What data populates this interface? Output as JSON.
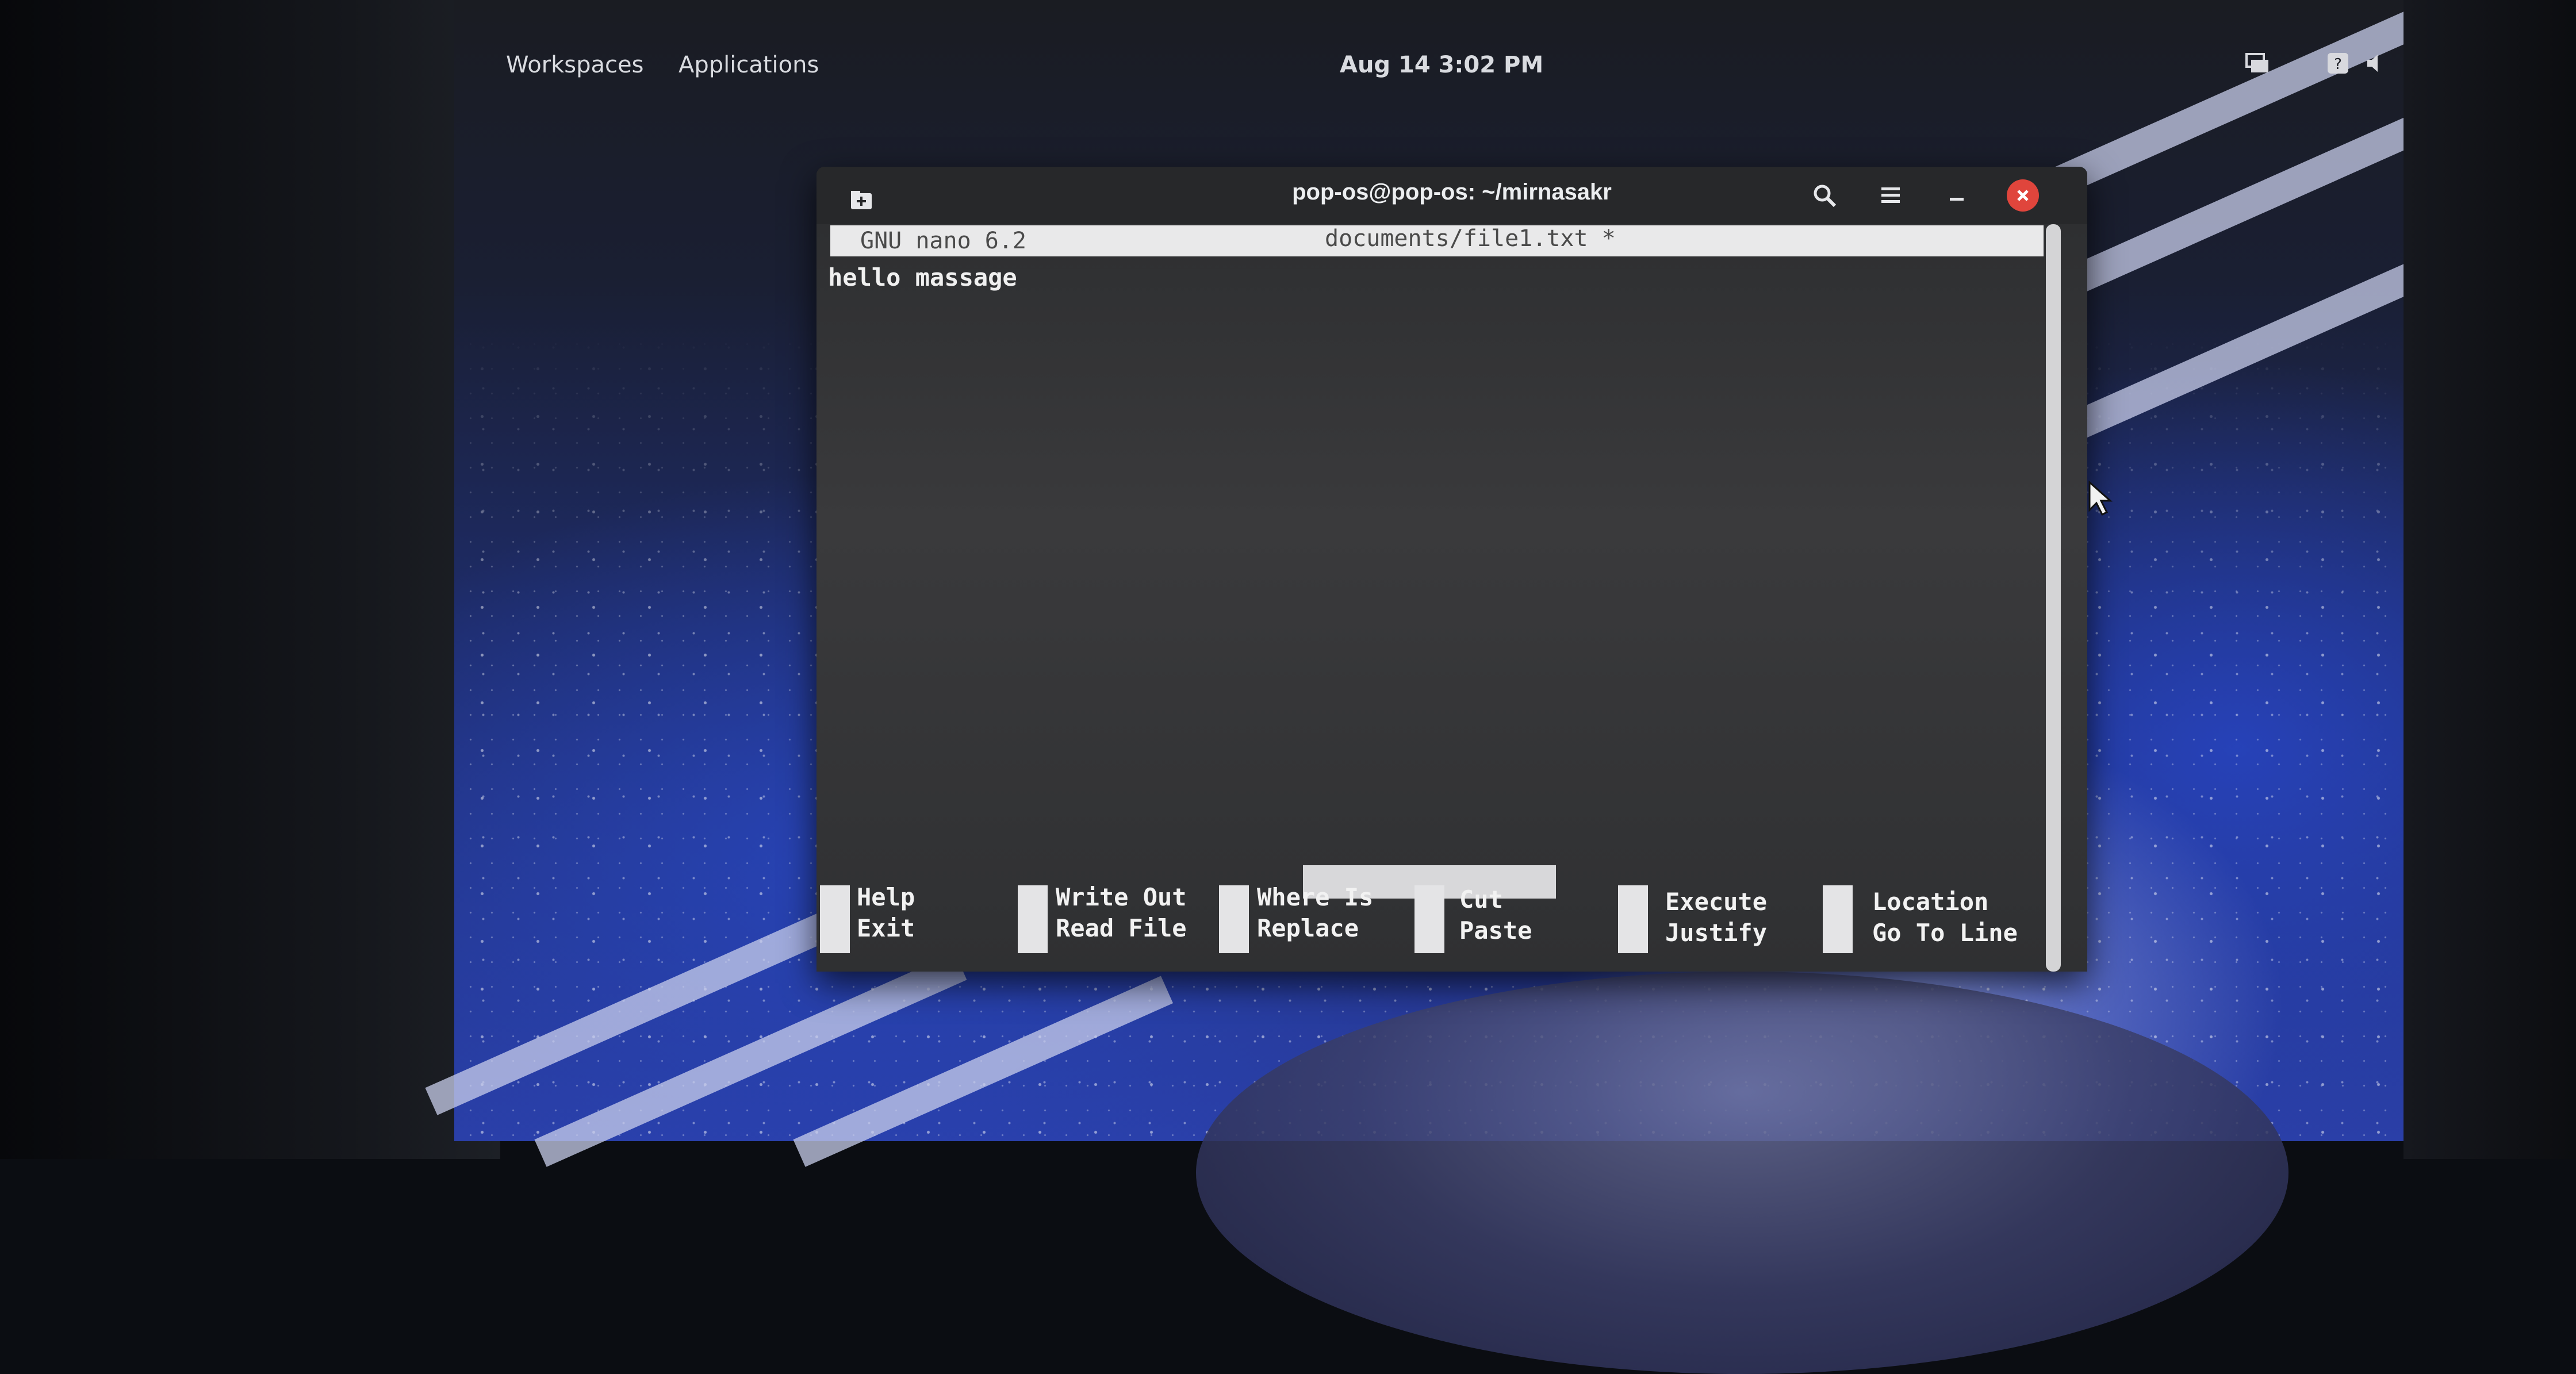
{
  "top_bar": {
    "workspaces": "Workspaces",
    "applications": "Applications",
    "clock": "Aug 14   3:02 PM",
    "tray_icons": [
      "display-icon",
      "help-icon",
      "volume-icon",
      "power-icon"
    ]
  },
  "terminal": {
    "title": "pop-os@pop-os: ~/mirnasakr",
    "header_icons": [
      "new-tab-icon",
      "search-icon",
      "hamburger-menu-icon",
      "minimize-icon",
      "close-icon"
    ]
  },
  "nano": {
    "version": "GNU nano 6.2",
    "filename": "documents/file1.txt *",
    "content": "hello massage",
    "shortcuts": [
      {
        "top": "Help",
        "bottom": "Exit"
      },
      {
        "top": "Write Out",
        "bottom": "Read File"
      },
      {
        "top": "Where Is",
        "bottom": "Replace"
      },
      {
        "top": "Cut",
        "bottom": "Paste"
      },
      {
        "top": "Execute",
        "bottom": "Justify"
      },
      {
        "top": "Location",
        "bottom": "Go To Line"
      }
    ]
  },
  "colors": {
    "close_button": "#e0453c",
    "terminal_bg": "#2a2b2d",
    "nano_bar": "#e9e9ea"
  }
}
